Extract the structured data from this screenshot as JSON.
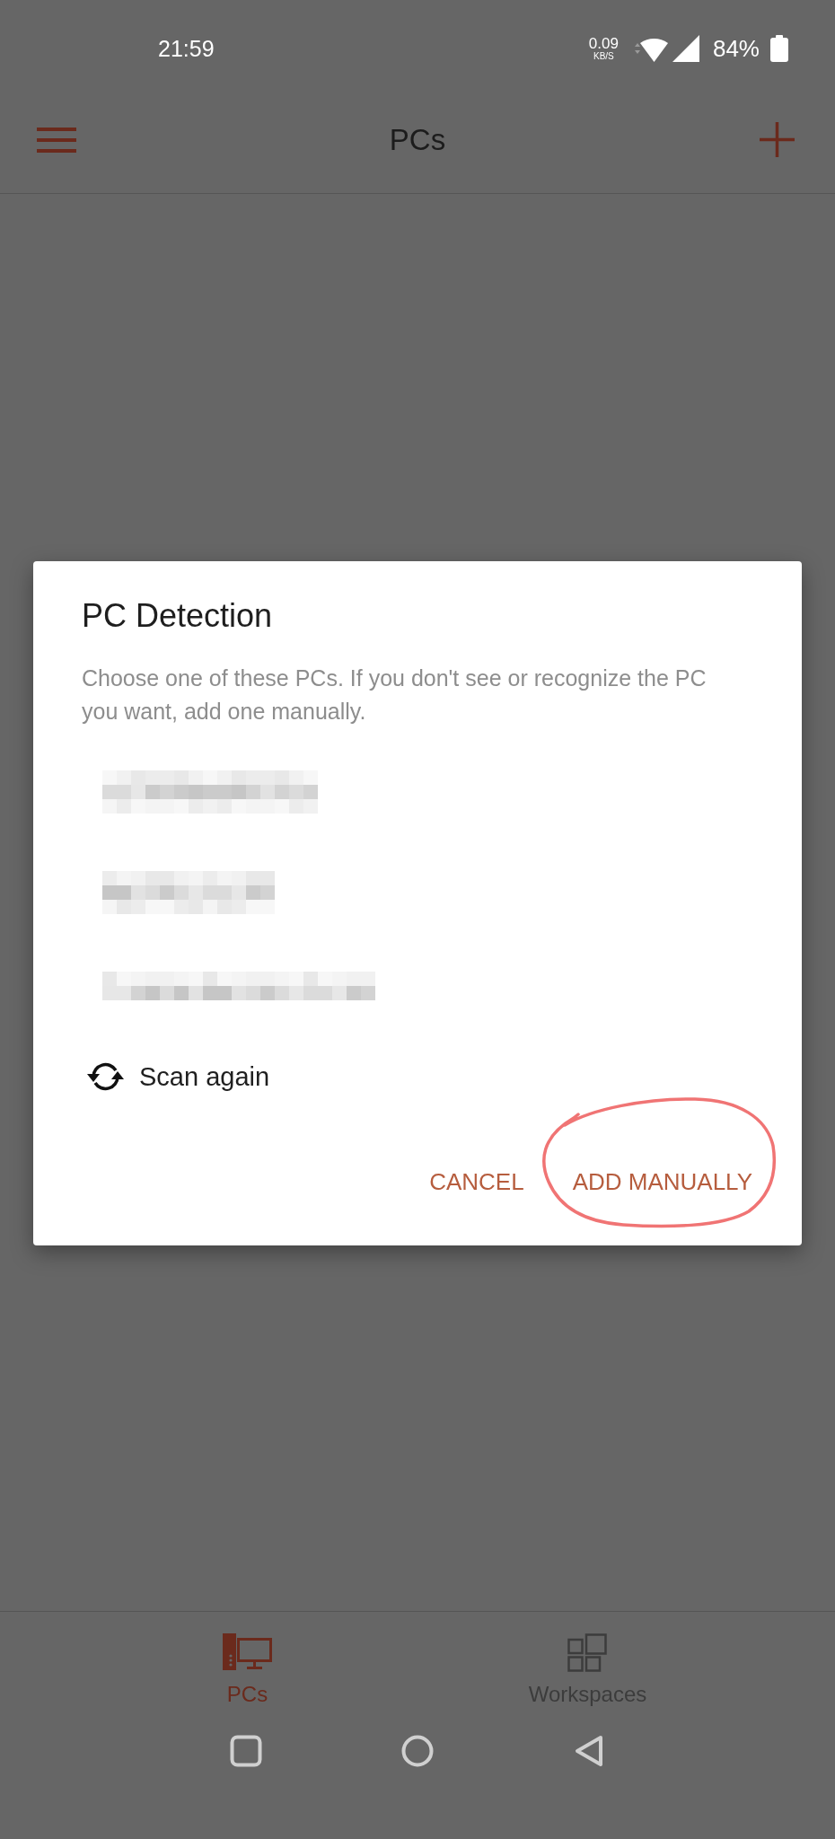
{
  "status_bar": {
    "time": "21:59",
    "net_speed": "0.09",
    "net_speed_unit": "KB/S",
    "battery": "84%"
  },
  "app_bar": {
    "title": "PCs"
  },
  "dialog": {
    "title": "PC Detection",
    "message": "Choose one of these PCs. If you don't see or recognize the PC you want, add one manually.",
    "pcs": [
      {
        "kind": "pixelated"
      },
      {
        "kind": "pixelated"
      },
      {
        "kind": "pixelated"
      }
    ],
    "scan_label": "Scan again",
    "buttons": [
      {
        "label": "CANCEL",
        "circled": false
      },
      {
        "label": "ADD MANUALLY",
        "circled": true
      }
    ]
  },
  "bottom_tabs": [
    {
      "kind": "pcs",
      "label": "PCs",
      "selected": true
    },
    {
      "kind": "workspaces",
      "label": "Workspaces",
      "selected": false
    }
  ]
}
